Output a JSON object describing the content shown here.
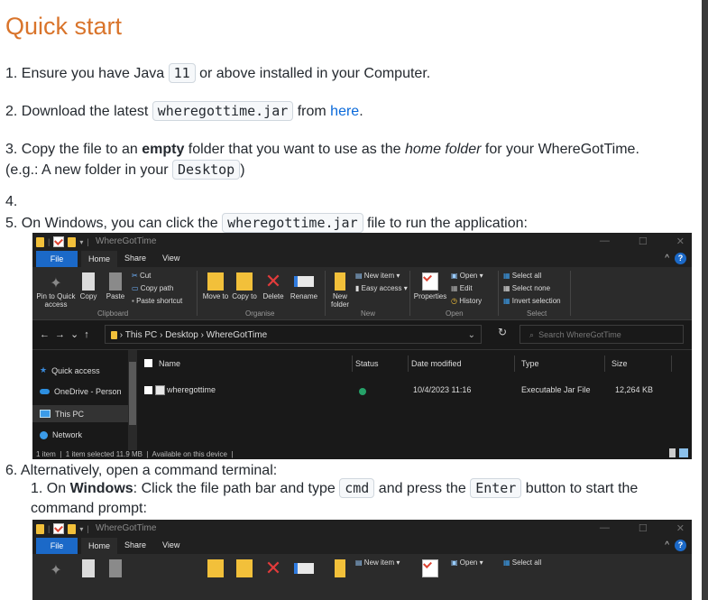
{
  "heading": "Quick start",
  "steps": {
    "s1": {
      "num": "1.",
      "pre": "Ensure you have Java ",
      "code": "11",
      "post": " or above installed in your Computer."
    },
    "s2": {
      "num": "2.",
      "pre": "Download the latest ",
      "code": "wheregottime.jar",
      "mid": " from ",
      "link": "here",
      "post": "."
    },
    "s3": {
      "num": "3.",
      "pre": "Copy the file to an ",
      "bold": "empty",
      "mid": " folder that you want to use as the ",
      "italic": "home folder",
      "post": " for your WhereGotTime.",
      "line2_pre": "(e.g.: A new folder in your ",
      "line2_code": "Desktop",
      "line2_post": ")"
    },
    "s4": {
      "num": "4."
    },
    "s5": {
      "num": "5.",
      "pre": "On Windows, you can click the ",
      "code": "wheregottime.jar",
      "post": " file to run the application:"
    },
    "s6": {
      "num": "6.",
      "text": "Alternatively, open a command terminal:"
    },
    "s6_1": {
      "num": "1.",
      "pre": "On ",
      "bold": "Windows",
      "mid": ": Click the file path bar and type ",
      "code": "cmd",
      "mid2": " and press the ",
      "code2": "Enter",
      "post": " button to start the",
      "line2": "command prompt:"
    }
  },
  "explorer": {
    "title": "WhereGotTime",
    "tabs": {
      "file": "File",
      "home": "Home",
      "share": "Share",
      "view": "View"
    },
    "ribbon": {
      "pin": "Pin to Quick access",
      "copy": "Copy",
      "paste": "Paste",
      "cut": "Cut",
      "copy_path": "Copy path",
      "paste_shortcut": "Paste shortcut",
      "move_to": "Move to",
      "copy_to": "Copy to",
      "delete": "Delete",
      "rename": "Rename",
      "new_folder": "New folder",
      "new_item": "New item",
      "easy_access": "Easy access",
      "properties": "Properties",
      "open": "Open",
      "edit": "Edit",
      "history": "History",
      "select_all": "Select all",
      "select_none": "Select none",
      "invert_selection": "Invert selection",
      "groups": {
        "clipboard": "Clipboard",
        "organise": "Organise",
        "new": "New",
        "open": "Open",
        "select": "Select"
      }
    },
    "path": {
      "this_pc": "This PC",
      "desktop": "Desktop",
      "folder": "WhereGotTime"
    },
    "search_placeholder": "Search WhereGotTime",
    "nav": {
      "quick_access": "Quick access",
      "onedrive": "OneDrive - Person",
      "this_pc": "This PC",
      "network": "Network"
    },
    "columns": {
      "name": "Name",
      "status": "Status",
      "date": "Date modified",
      "type": "Type",
      "size": "Size"
    },
    "file": {
      "name": "wheregottime",
      "date": "10/4/2023 11:16",
      "type": "Executable Jar File",
      "size": "12,264 KB"
    },
    "status_bar": {
      "items": "1 item",
      "selected": "1 item selected  11.9 MB",
      "avail": "Available on this device"
    }
  },
  "colors": {
    "heading": "#d9742b",
    "link": "#0969da",
    "explorer_bg": "#191919",
    "accent": "#1b69c8"
  }
}
